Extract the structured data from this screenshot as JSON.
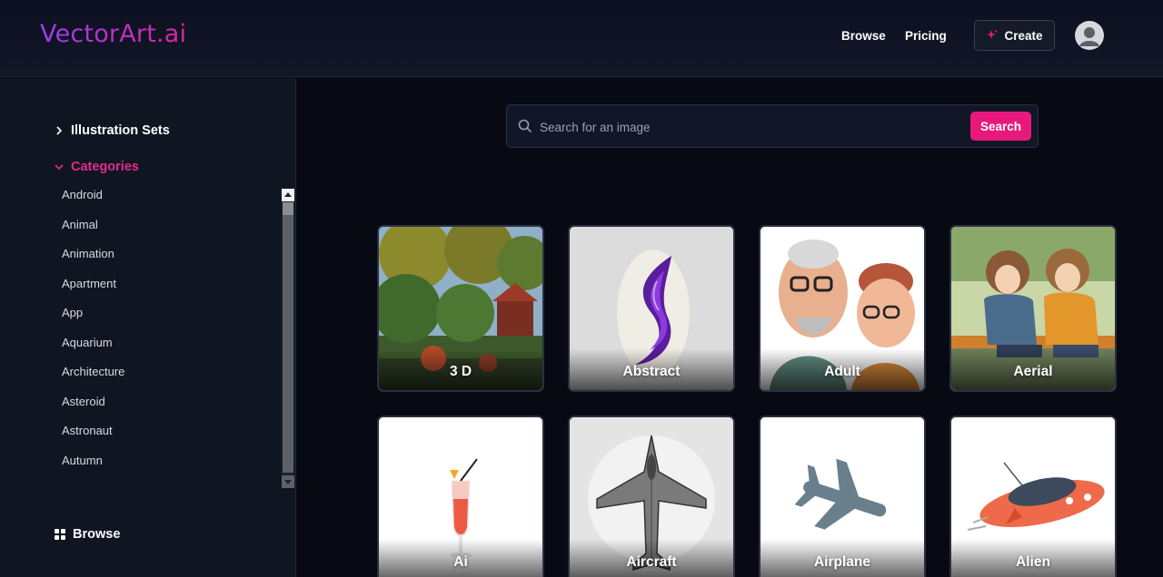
{
  "header": {
    "logo": "VectorArt.ai",
    "nav": {
      "browse": "Browse",
      "pricing": "Pricing"
    },
    "create_label": "Create"
  },
  "sidebar": {
    "illustration_sets": "Illustration Sets",
    "categories_heading": "Categories",
    "categories": [
      "Android",
      "Animal",
      "Animation",
      "Apartment",
      "App",
      "Aquarium",
      "Architecture",
      "Asteroid",
      "Astronaut",
      "Autumn"
    ],
    "browse": "Browse"
  },
  "search": {
    "placeholder": "Search for an image",
    "button": "Search"
  },
  "cards": [
    {
      "label": "3 D"
    },
    {
      "label": "Abstract"
    },
    {
      "label": "Adult"
    },
    {
      "label": "Aerial"
    },
    {
      "label": "Ai"
    },
    {
      "label": "Aircraft"
    },
    {
      "label": "Airplane"
    },
    {
      "label": "Alien"
    }
  ],
  "colors": {
    "accent": "#e8197c",
    "background": "#070913",
    "sidebar": "#101522"
  }
}
